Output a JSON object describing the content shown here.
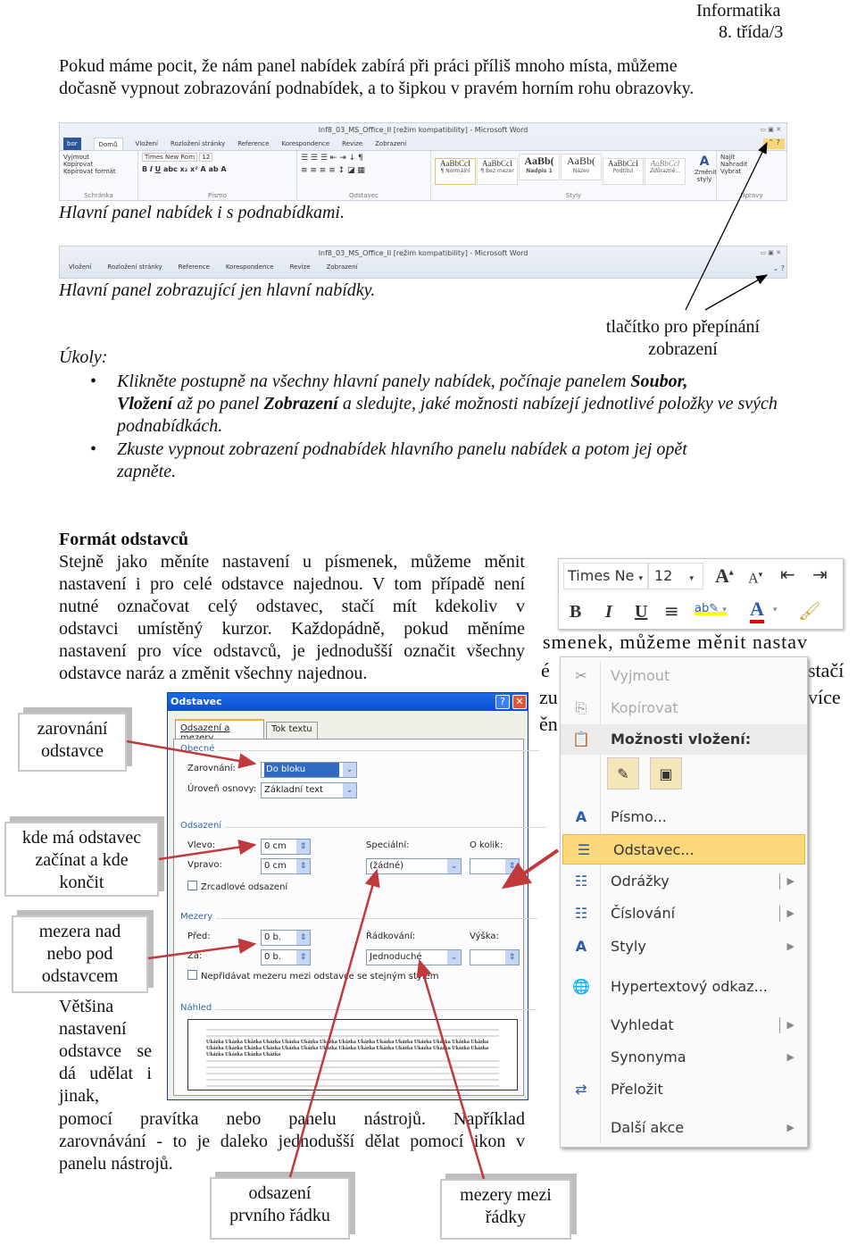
{
  "header": {
    "subject": "Informatika",
    "class": "8. třída/3"
  },
  "intro": [
    "Pokud máme pocit, že nám panel nabídek zabírá při práci příliš mnoho místa, můžeme",
    "dočasně vypnout zobrazování podnabídek, a to šipkou v pravém horním rohu obrazovky."
  ],
  "ribbon_full": {
    "title": "Inf8_03_MS_Office_II [režim kompatibility] - Microsoft Word",
    "tabs": [
      "bor",
      "Domů",
      "Vložení",
      "Rozložení stránky",
      "Reference",
      "Korespondence",
      "Revize",
      "Zobrazení"
    ],
    "clipboard": [
      "Vyjmout",
      "Kopírovat",
      "Kopírovat formát"
    ],
    "groups": [
      "Schránka",
      "Písmo",
      "Odstavec",
      "Styly",
      "Úpravy"
    ],
    "font": "Times New Rom",
    "size": "12",
    "styles": [
      {
        "sample": "AaBbCcI",
        "name": "¶ Normální"
      },
      {
        "sample": "AaBbCcI",
        "name": "¶ Bez mezer"
      },
      {
        "sample": "AaBb(",
        "name": "Nadpis 1"
      },
      {
        "sample": "AaBb(",
        "name": "Název"
      },
      {
        "sample": "AaBbCcI",
        "name": "Podtitul"
      },
      {
        "sample": "AaBbCcl",
        "name": "Zdůrazně..."
      }
    ],
    "change_styles": "Změnit styly",
    "editing": [
      "Najít",
      "Nahradit",
      "Vybrat"
    ]
  },
  "caption1": "Hlavní panel nabídek i s podnabídkami.",
  "ribbon_min": {
    "title": "Inf8_03_MS_Office_II [režim kompatibility] - Microsoft Word",
    "tabs": [
      "Vložení",
      "Rozložení stránky",
      "Reference",
      "Korespondence",
      "Revize",
      "Zobrazení"
    ]
  },
  "caption2": "Hlavní panel zobrazující jen hlavní nabídky.",
  "toggle_note": [
    "tlačítko pro přepínání",
    "zobrazení"
  ],
  "tasks": {
    "heading": "Úkoly:",
    "items": [
      [
        "Klikněte postupně na všechny hlavní panely nabídek, počínaje panelem ",
        "Soubor,",
        "Vložení",
        " až po panel ",
        "Zobrazení",
        " a sledujte, jaké možnosti nabízejí jednotlivé položky ve svých podnabídkách."
      ],
      [
        "Zkuste vypnout zobrazení podnabídek hlavního panelu nabídek a potom jej opět zapněte."
      ]
    ]
  },
  "section": {
    "title": "Formát odstavců",
    "para": [
      "Stejně jako měníte nastavení u písmenek, můžeme měnit",
      "nastavení i pro celé odstavce najednou. V tom případě není",
      "nutné označovat celý odstavec, stačí mít kdekoliv v",
      "odstavci umístěný kurzor. Každopádně, pokud měníme",
      "nastavení pro více odstavců, je jednodušší označit všechny",
      "odstavce naráz a změnit všechny najednou."
    ],
    "para2": [
      "Většina",
      "nastavení",
      "odstavce se",
      "dá udělat i",
      "jinak,"
    ],
    "para3": [
      "pomocí pravítka nebo panelu nástrojů. Například",
      "zarovnávání - to je daleko jednodušší dělat pomocí ikon v",
      "panelu nástrojů."
    ]
  },
  "callouts": {
    "align": [
      "zarovnání",
      "odstavce"
    ],
    "indent": [
      "kde má odstavec",
      "začínat a kde",
      "končit"
    ],
    "spacing": [
      "mezera nad",
      "nebo pod",
      "odstavcem"
    ],
    "first_line": [
      "odsazení",
      "prvního řádku"
    ],
    "line_spacing": [
      "mezery mezi",
      "řádky"
    ]
  },
  "dialog": {
    "title": "Odstavec",
    "tabs": [
      "Odsazení a mezery",
      "Tok textu"
    ],
    "general": "Obecné",
    "alignment_label": "Zarovnání:",
    "alignment": "Do bloku",
    "outline_label": "Úroveň osnovy:",
    "outline": "Základní text",
    "indent": "Odsazení",
    "left_label": "Vlevo:",
    "left": "0 cm",
    "right_label": "Vpravo:",
    "right": "0 cm",
    "special_label": "Speciální:",
    "special": "(žádné)",
    "by_label": "O kolik:",
    "mirror": "Zrcadlové odsazení",
    "spacing": "Mezery",
    "before_label": "Před:",
    "before": "0 b.",
    "after_label": "Za:",
    "after": "0 b.",
    "line_label": "Řádkování:",
    "line": "Jednoduché",
    "at_label": "Výška:",
    "no_space": "Nepřidávat mezeru mezi odstavce se stejným stylem",
    "preview": "Náhled",
    "preview_sample": "Ukázka"
  },
  "mini_toolbar": {
    "font": "Times Ne",
    "size": "12"
  },
  "context_menu": {
    "behind_text": [
      "smenek, můžeme měnit nastav",
      "é",
      "stačí",
      "zu",
      "více",
      "ěn"
    ],
    "items": [
      "Vyjmout",
      "Kopírovat",
      "Možnosti vložení:",
      "Písmo...",
      "Odstavec...",
      "Odrážky",
      "Číslování",
      "Styly",
      "Hypertextový odkaz...",
      "Vyhledat",
      "Synonyma",
      "Přeložit",
      "Další akce"
    ]
  },
  "colors": {
    "arrow_red": "#c0393b",
    "dialog_title": "#0a5fd8",
    "highlight": "#fbd97a",
    "word_blue": "#2b579a"
  }
}
